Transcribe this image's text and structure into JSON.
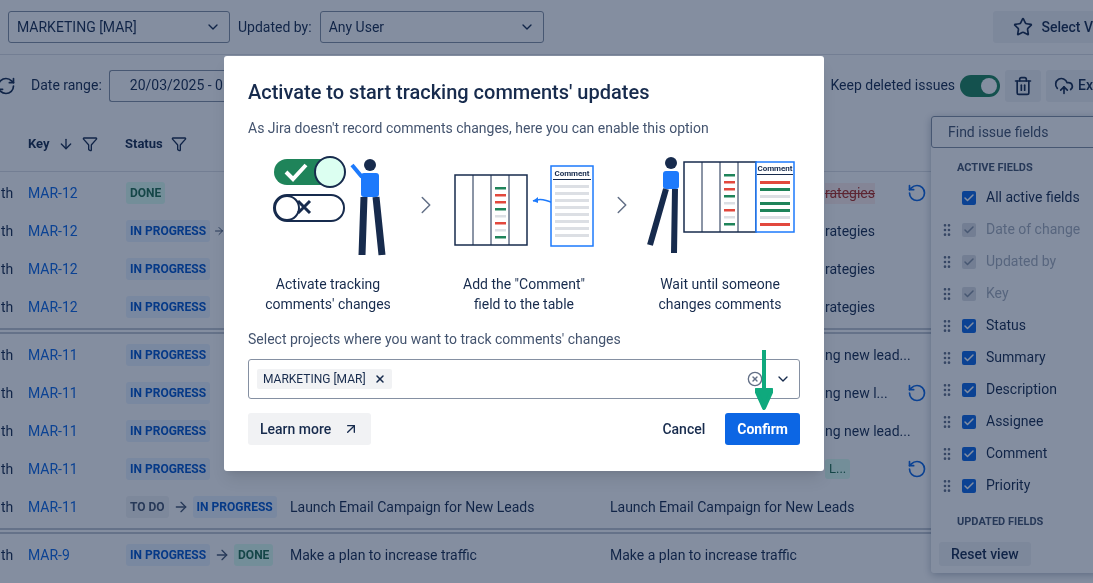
{
  "filters": {
    "project": "MARKETING [MAR]",
    "updated_by_label": "Updated by:",
    "updated_by": "Any User",
    "select_view": "Select V"
  },
  "toolbar": {
    "date_label": "Date range:",
    "date_value": "20/03/2025 - 0",
    "keep_deleted_label": "Keep deleted issues",
    "keep_deleted_on": true,
    "export": "Ex"
  },
  "table": {
    "columns": [
      {
        "label": "Key",
        "sort": true
      },
      {
        "label": "Status",
        "sort": false
      }
    ],
    "groups": [
      {
        "rows": [
          {
            "kind": "covered",
            "col_1": "th",
            "key": "MAR-12",
            "statuses": [
              {
                "label": "DONE",
                "kind": "done"
              }
            ],
            "continues": false,
            "fragment": "rategies",
            "removed": true,
            "undo": true
          },
          {
            "kind": "covered",
            "col_1": "th",
            "key": "MAR-12",
            "statuses": [
              {
                "label": "IN PROGRESS",
                "kind": "in_progress"
              }
            ],
            "continues": true,
            "fragment": "rategies",
            "removed": false,
            "undo": false
          },
          {
            "kind": "covered",
            "col_1": "th",
            "key": "MAR-12",
            "statuses": [
              {
                "label": "IN PROGRESS",
                "kind": "in_progress"
              }
            ],
            "continues": false,
            "fragment": "rategies",
            "removed": false,
            "undo": false
          },
          {
            "kind": "covered",
            "col_1": "th",
            "key": "MAR-12",
            "statuses": [
              {
                "label": "IN PROGRESS",
                "kind": "in_progress"
              }
            ],
            "continues": false,
            "fragment": "rategies",
            "removed": false,
            "undo": false
          }
        ]
      },
      {
        "rows": [
          {
            "kind": "covered",
            "col_1": "th",
            "key": "MAR-11",
            "statuses": [
              {
                "label": "IN PROGRESS",
                "kind": "in_progress"
              }
            ],
            "continues": false,
            "fragment": "ng new lead...",
            "removed": false,
            "undo": false
          },
          {
            "kind": "covered",
            "col_1": "th",
            "key": "MAR-11",
            "statuses": [
              {
                "label": "IN PROGRESS",
                "kind": "in_progress"
              }
            ],
            "continues": false,
            "fragment": "ng new l...",
            "removed": false,
            "undo": true
          },
          {
            "kind": "covered",
            "col_1": "th",
            "key": "MAR-11",
            "statuses": [
              {
                "label": "IN PROGRESS",
                "kind": "in_progress"
              }
            ],
            "continues": false,
            "fragment": "ng new lead...",
            "removed": false,
            "undo": false
          },
          {
            "kind": "covered",
            "col_1": "th",
            "key": "MAR-11",
            "statuses": [
              {
                "label": "IN PROGRESS",
                "kind": "in_progress"
              }
            ],
            "continues": false,
            "tag": "L...",
            "undo": true
          },
          {
            "kind": "full",
            "col_1": "th",
            "key": "MAR-11",
            "statuses": [
              {
                "label": "TO DO",
                "kind": "todo"
              },
              {
                "label": "IN PROGRESS",
                "kind": "in_progress"
              }
            ],
            "continues": false,
            "summary": "Launch Email Campaign for New Leads",
            "description": "Launch Email Campaign for New Leads",
            "undo": false
          }
        ]
      },
      {
        "rows": [
          {
            "kind": "full",
            "col_1": "th",
            "key": "MAR-9",
            "statuses": [
              {
                "label": "IN PROGRESS",
                "kind": "in_progress"
              },
              {
                "label": "DONE",
                "kind": "done"
              }
            ],
            "continues": false,
            "summary": "Make a plan to increase traffic",
            "description": "Make a plan to increase traffic",
            "undo": false
          }
        ]
      }
    ]
  },
  "fields_panel": {
    "search_placeholder": "Find issue fields",
    "active_heading": "ACTIVE FIELDS",
    "fields": [
      {
        "label": "All active fields",
        "checked": true,
        "disabled": false,
        "draggable": false
      },
      {
        "label": "Date of change",
        "checked": true,
        "disabled": true,
        "draggable": true
      },
      {
        "label": "Updated by",
        "checked": true,
        "disabled": true,
        "draggable": true
      },
      {
        "label": "Key",
        "checked": true,
        "disabled": true,
        "draggable": true
      },
      {
        "label": "Status",
        "checked": true,
        "disabled": false,
        "draggable": true
      },
      {
        "label": "Summary",
        "checked": true,
        "disabled": false,
        "draggable": true
      },
      {
        "label": "Description",
        "checked": true,
        "disabled": false,
        "draggable": true
      },
      {
        "label": "Assignee",
        "checked": true,
        "disabled": false,
        "draggable": true
      },
      {
        "label": "Comment",
        "checked": true,
        "disabled": false,
        "draggable": true
      },
      {
        "label": "Priority",
        "checked": true,
        "disabled": false,
        "draggable": true
      }
    ],
    "updated_heading": "UPDATED FIELDS",
    "reset": "Reset view"
  },
  "modal": {
    "title": "Activate to start tracking comments' updates",
    "subtitle": "As Jira doesn't record comments changes, here you can enable this option",
    "steps": [
      {
        "kind": "toggle",
        "caption": "Activate tracking comments' changes"
      },
      {
        "kind": "add_column",
        "caption": "Add the \"Comment\" field to the table",
        "column_label": "Comment"
      },
      {
        "kind": "wait",
        "caption": "Wait until someone changes comments",
        "column_label": "Comment"
      }
    ],
    "select_label": "Select projects where you want to track comments' changes",
    "selected_projects": [
      "MARKETING [MAR]"
    ],
    "learn_more": "Learn more",
    "cancel": "Cancel",
    "confirm": "Confirm"
  }
}
